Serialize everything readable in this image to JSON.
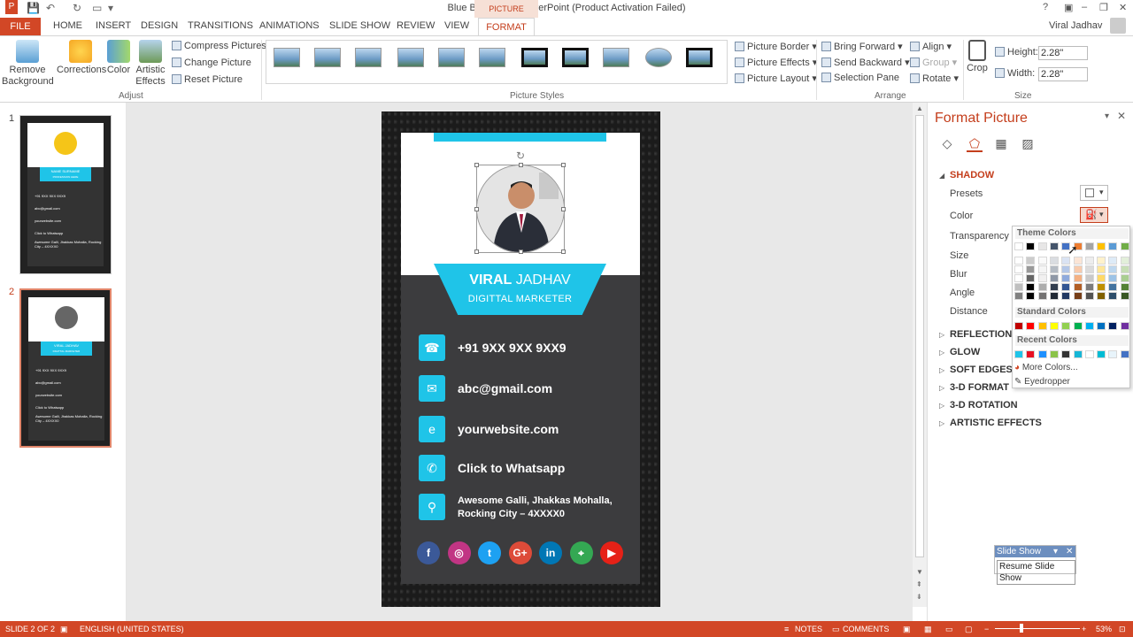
{
  "window": {
    "title": "Blue Boat.pptx - PowerPoint (Product Activation Failed)",
    "picture_tools_label": "PICTURE TOOLS",
    "help": "?",
    "minimize": "–",
    "restore": "❐",
    "close": "✕"
  },
  "tabs": [
    "FILE",
    "HOME",
    "INSERT",
    "DESIGN",
    "TRANSITIONS",
    "ANIMATIONS",
    "SLIDE SHOW",
    "REVIEW",
    "VIEW",
    "FORMAT"
  ],
  "user": {
    "name": "Viral Jadhav"
  },
  "ribbon": {
    "adjust": {
      "remove_background": "Remove Background",
      "corrections": "Corrections",
      "color": "Color",
      "artistic_effects": "Artistic Effects",
      "compress": "Compress Pictures",
      "change": "Change Picture",
      "reset": "Reset Picture",
      "group_label": "Adjust"
    },
    "styles": {
      "group_label": "Picture Styles",
      "border": "Picture Border",
      "effects": "Picture Effects",
      "layout": "Picture Layout"
    },
    "arrange": {
      "bring_forward": "Bring Forward",
      "send_backward": "Send Backward",
      "selection_pane": "Selection Pane",
      "align": "Align",
      "group": "Group",
      "rotate": "Rotate",
      "group_label": "Arrange"
    },
    "size": {
      "crop": "Crop",
      "height_label": "Height:",
      "height_value": "2.28\"",
      "width_label": "Width:",
      "width_value": "2.28\"",
      "group_label": "Size"
    }
  },
  "slides": [
    {
      "number": "1"
    },
    {
      "number": "2"
    }
  ],
  "thumb": {
    "name1": "NAME SURNAME",
    "role1": "PROFESSION HERE",
    "name2": "VIRAL JADHAV",
    "role2": "DIGITTAL MARKETER",
    "phone": "+91 9XX 9XX 9XX9",
    "email": "abc@gmail.com",
    "web": "yourwebsite.com",
    "whatsapp": "Click to Whatsapp",
    "address": "Awesome Galli, Jhakkas Mohalla, Rocking City – 4XXXX0"
  },
  "card": {
    "first_name": "VIRAL",
    "last_name": " JADHAV",
    "job_title": "DIGITTAL MARKETER",
    "phone": "+91 9XX 9XX 9XX9",
    "email": "abc@gmail.com",
    "website": "yourwebsite.com",
    "whatsapp": "Click to Whatsapp",
    "address_line1": "Awesome Galli, Jhakkas Mohalla,",
    "address_line2": "Rocking City – 4XXXX0",
    "icons": {
      "phone": "☎",
      "email": "✉",
      "web": "e",
      "whatsapp": "✆",
      "location": "⚲"
    },
    "social": [
      {
        "name": "facebook-icon",
        "glyph": "f",
        "color": "#3b5998"
      },
      {
        "name": "instagram-icon",
        "glyph": "◎",
        "color": "#c13584"
      },
      {
        "name": "twitter-icon",
        "glyph": "t",
        "color": "#1da1f2"
      },
      {
        "name": "google-plus-icon",
        "glyph": "G+",
        "color": "#dd4b39"
      },
      {
        "name": "linkedin-icon",
        "glyph": "in",
        "color": "#0077b5"
      },
      {
        "name": "maps-icon",
        "glyph": "⌖",
        "color": "#34a853"
      },
      {
        "name": "youtube-icon",
        "glyph": "▶",
        "color": "#e62117"
      }
    ]
  },
  "format_pane": {
    "title": "Format Picture",
    "shadow": "SHADOW",
    "presets": "Presets",
    "color": "Color",
    "transparency": "Transparency",
    "size": "Size",
    "blur": "Blur",
    "angle": "Angle",
    "distance": "Distance",
    "reflection": "REFLECTION",
    "glow": "GLOW",
    "soft_edges": "SOFT EDGES",
    "format_3d": "3-D FORMAT",
    "rotation_3d": "3-D ROTATION",
    "artistic_effects": "ARTISTIC EFFECTS"
  },
  "color_picker": {
    "theme_colors": "Theme Colors",
    "standard_colors": "Standard Colors",
    "recent_colors": "Recent Colors",
    "more_colors": "More Colors...",
    "eyedropper": "Eyedropper",
    "theme_swatches": [
      "#ffffff",
      "#000000",
      "#e7e6e6",
      "#44546a",
      "#4472c4",
      "#ed7d31",
      "#a5a5a5",
      "#ffc000",
      "#5b9bd5",
      "#70ad47"
    ],
    "standard_swatches": [
      "#c00000",
      "#ff0000",
      "#ffc000",
      "#ffff00",
      "#92d050",
      "#00b050",
      "#00b0f0",
      "#0070c0",
      "#002060",
      "#7030a0"
    ],
    "recent_swatches": [
      "#1fc4e8",
      "#e81123",
      "#1e90ff",
      "#8bc34a",
      "#333333",
      "#17b6d6",
      "#ffffff",
      "#00bcd4",
      "#e8f4fb",
      "#4472c4"
    ]
  },
  "slideshow_mini": {
    "title": "Slide Show",
    "resume": "Resume Slide Show"
  },
  "status": {
    "slide": "SLIDE 2 OF 2",
    "language": "ENGLISH (UNITED STATES)",
    "notes": "NOTES",
    "comments": "COMMENTS",
    "zoom": "53%"
  }
}
